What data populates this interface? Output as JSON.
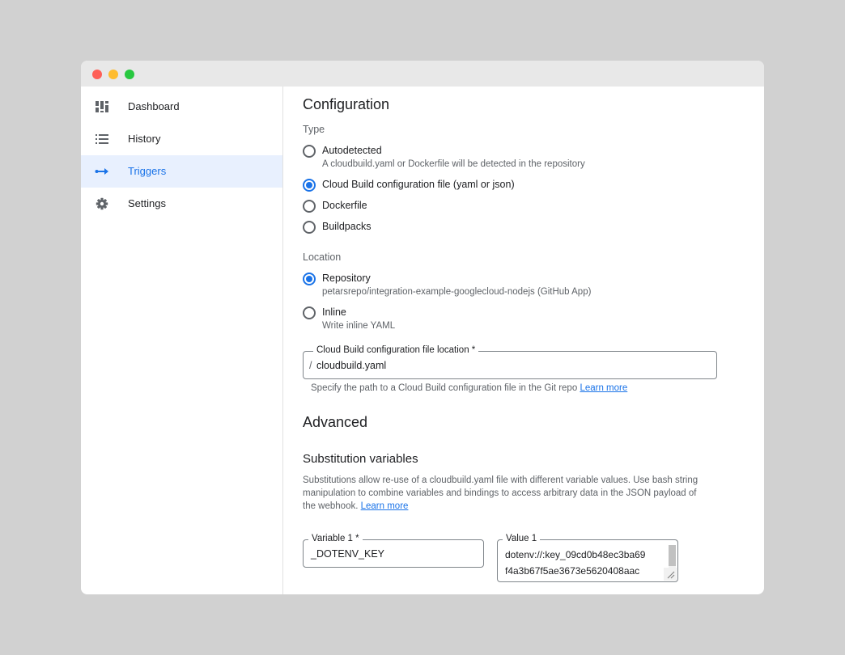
{
  "sidebar": {
    "items": [
      {
        "label": "Dashboard",
        "icon": "dashboard-icon",
        "active": false
      },
      {
        "label": "History",
        "icon": "list-icon",
        "active": false
      },
      {
        "label": "Triggers",
        "icon": "triggers-arrow-icon",
        "active": true
      },
      {
        "label": "Settings",
        "icon": "gear-icon",
        "active": false
      }
    ]
  },
  "configuration": {
    "title": "Configuration",
    "type_label": "Type",
    "type_options": [
      {
        "label": "Autodetected",
        "help": "A cloudbuild.yaml or Dockerfile will be detected in the repository",
        "checked": false
      },
      {
        "label": "Cloud Build configuration file (yaml or json)",
        "checked": true
      },
      {
        "label": "Dockerfile",
        "checked": false
      },
      {
        "label": "Buildpacks",
        "checked": false
      }
    ],
    "location_label": "Location",
    "location_options": [
      {
        "label": "Repository",
        "help": "petarsrepo/integration-example-googlecloud-nodejs (GitHub App)",
        "checked": true
      },
      {
        "label": "Inline",
        "help": "Write inline YAML",
        "checked": false
      }
    ],
    "file_location": {
      "label": "Cloud Build configuration file location *",
      "prefix": "/",
      "value": "cloudbuild.yaml",
      "hint": "Specify the path to a Cloud Build configuration file in the Git repo",
      "hint_link": "Learn more"
    }
  },
  "advanced": {
    "title": "Advanced",
    "substitution": {
      "title": "Substitution variables",
      "description_line1": "Substitutions allow re-use of a cloudbuild.yaml file with different variable values. Use bash string",
      "description_line2": "manipulation to combine variables and bindings to access arbitrary data in the JSON payload of",
      "description_line3": "the webhook.",
      "link": "Learn more",
      "variable": {
        "label": "Variable 1 *",
        "value": "_DOTENV_KEY"
      },
      "value": {
        "label": "Value 1",
        "line1": "dotenv://:key_09cd0b48ec3ba69",
        "line2": "f4a3b67f5ae3673e5620408aac"
      }
    }
  },
  "colors": {
    "accent": "#1a73e8",
    "active_bg": "#e8f0fe",
    "titlebar": "#e8e8e8",
    "backdrop": "#d1d1d1"
  }
}
